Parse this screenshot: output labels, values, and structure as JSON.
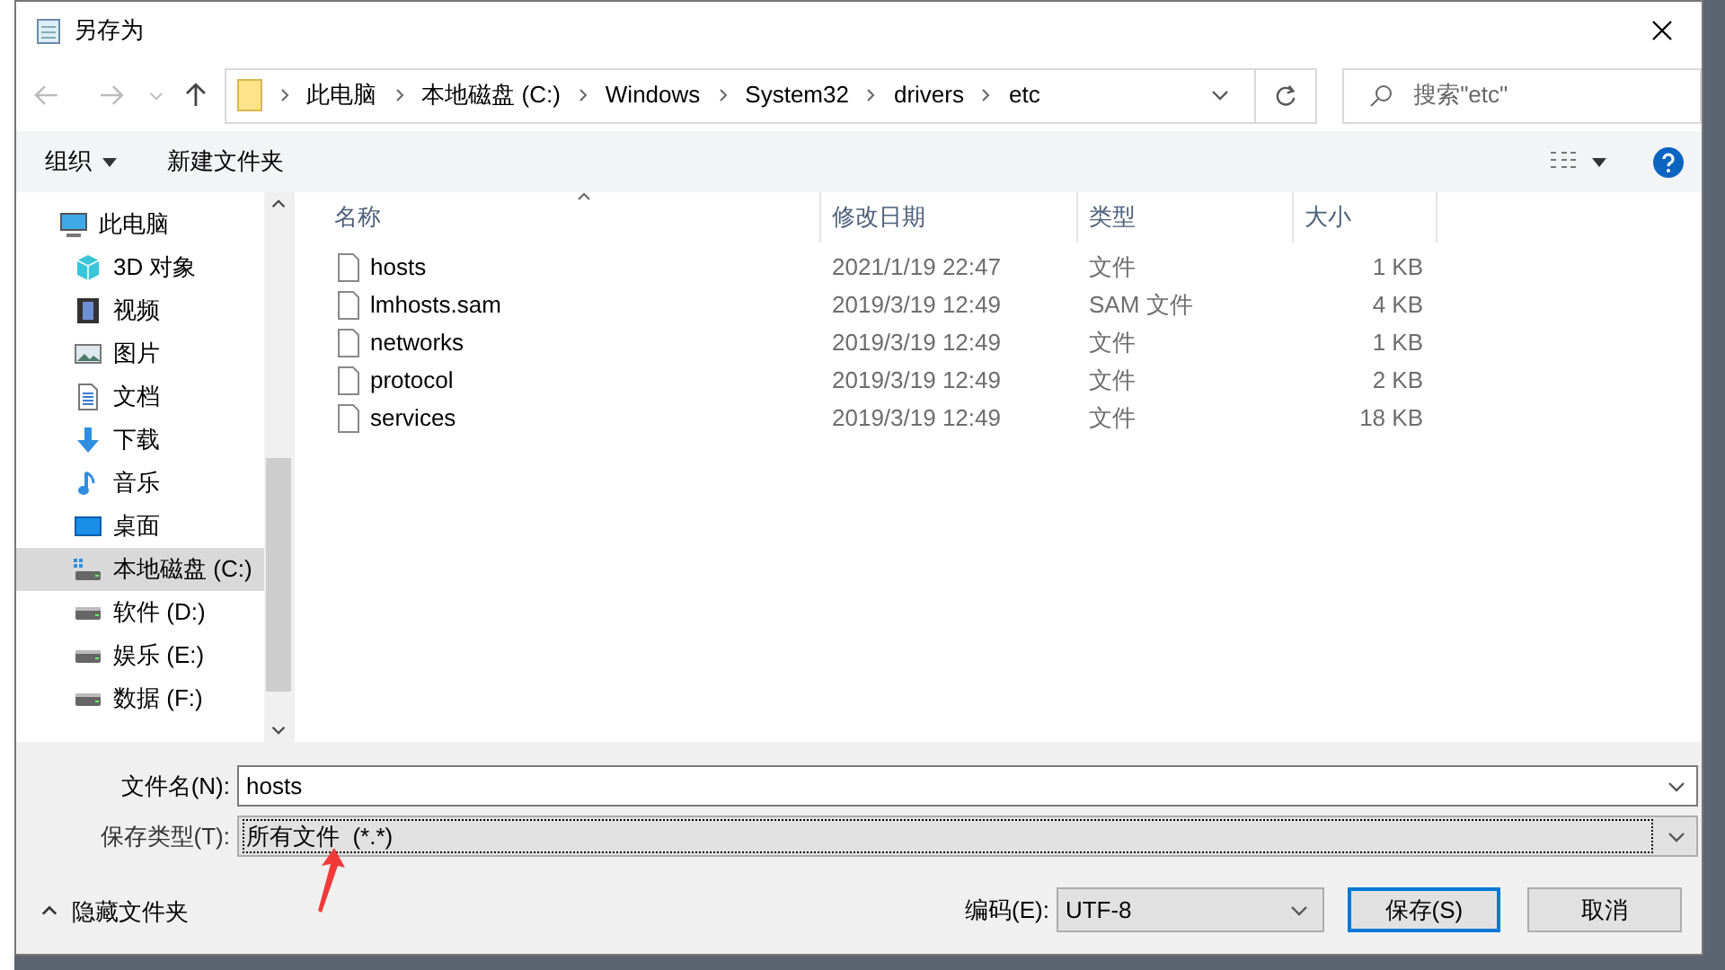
{
  "window": {
    "title": "另存为"
  },
  "address": {
    "crumbs": [
      "此电脑",
      "本地磁盘 (C:)",
      "Windows",
      "System32",
      "drivers",
      "etc"
    ]
  },
  "search": {
    "placeholder": "搜索\"etc\""
  },
  "toolbar": {
    "organize": "组织",
    "new_folder": "新建文件夹"
  },
  "nav": [
    {
      "label": "此电脑",
      "kind": "pc",
      "selected": false,
      "children": [
        {
          "label": "3D 对象",
          "kind": "cube",
          "selected": false
        },
        {
          "label": "视频",
          "kind": "video",
          "selected": false
        },
        {
          "label": "图片",
          "kind": "picture",
          "selected": false
        },
        {
          "label": "文档",
          "kind": "document",
          "selected": false
        },
        {
          "label": "下载",
          "kind": "download",
          "selected": false
        },
        {
          "label": "音乐",
          "kind": "music",
          "selected": false
        },
        {
          "label": "桌面",
          "kind": "desktop",
          "selected": false
        },
        {
          "label": "本地磁盘 (C:)",
          "kind": "system-drive",
          "selected": true
        },
        {
          "label": "软件 (D:)",
          "kind": "drive",
          "selected": false
        },
        {
          "label": "娱乐 (E:)",
          "kind": "drive",
          "selected": false
        },
        {
          "label": "数据 (F:)",
          "kind": "drive",
          "selected": false
        }
      ]
    }
  ],
  "table": {
    "columns": [
      "名称",
      "修改日期",
      "类型",
      "大小"
    ],
    "rows": [
      [
        "hosts",
        "2021/1/19 22:47",
        "文件",
        "1 KB"
      ],
      [
        "lmhosts.sam",
        "2019/3/19 12:49",
        "SAM 文件",
        "4 KB"
      ],
      [
        "networks",
        "2019/3/19 12:49",
        "文件",
        "1 KB"
      ],
      [
        "protocol",
        "2019/3/19 12:49",
        "文件",
        "2 KB"
      ],
      [
        "services",
        "2019/3/19 12:49",
        "文件",
        "18 KB"
      ]
    ]
  },
  "filename": {
    "label": "文件名(N):",
    "value": "hosts"
  },
  "filetype": {
    "label": "保存类型(T):",
    "value": "所有文件  (*.*)"
  },
  "hide_folders": "隐藏文件夹",
  "encoding": {
    "label": "编码(E):",
    "value": "UTF-8"
  },
  "buttons": {
    "save": "保存(S)",
    "cancel": "取消"
  }
}
